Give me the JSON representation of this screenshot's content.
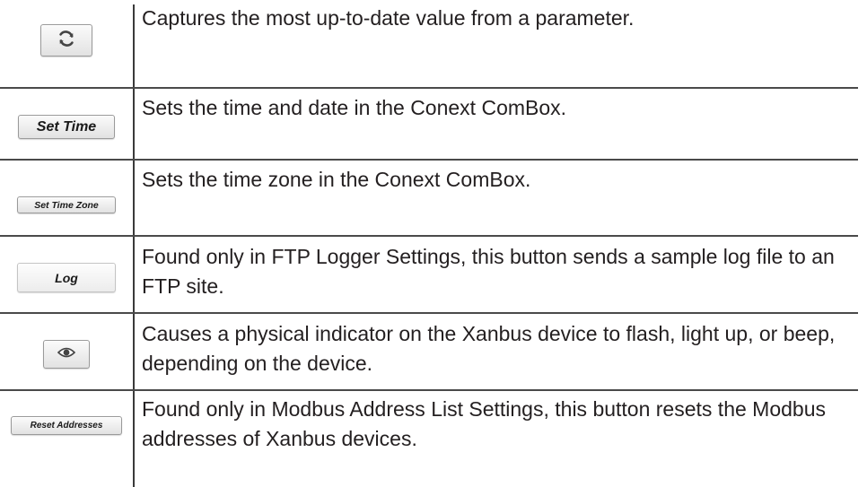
{
  "rows": [
    {
      "button": {
        "label": "",
        "icon": "refresh-icon"
      },
      "description": "Captures the most up-to-date value from a parameter."
    },
    {
      "button": {
        "label": "Set Time"
      },
      "description": "Sets the time and date in the Conext ComBox."
    },
    {
      "button": {
        "label": "Set Time Zone"
      },
      "description": "Sets the time zone in the Conext ComBox."
    },
    {
      "button": {
        "label": "Log"
      },
      "description": "Found only in FTP Logger Settings, this button sends a sample log file to an FTP site."
    },
    {
      "button": {
        "label": "",
        "icon": "eye-icon"
      },
      "description": "Causes a physical indicator on the Xanbus device to flash, light up, or beep, depending on the device."
    },
    {
      "button": {
        "label": "Reset Addresses"
      },
      "description": "Found only in Modbus Address List Settings, this button resets the Modbus addresses of Xanbus devices."
    }
  ]
}
